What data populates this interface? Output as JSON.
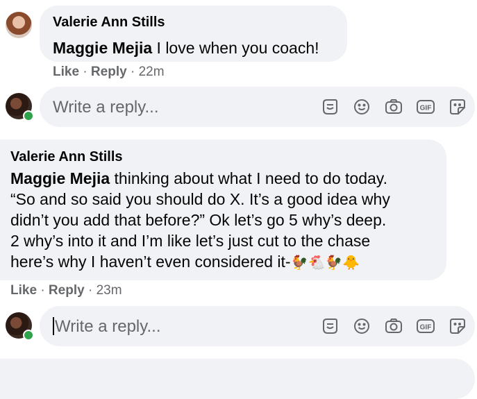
{
  "comment1": {
    "author": "Valerie Ann Stills",
    "mention": "Maggie Mejia",
    "text": " I love when you coach!",
    "like": "Like",
    "reply": "Reply",
    "time": "22m"
  },
  "replybox1": {
    "placeholder": "Write a reply..."
  },
  "comment2": {
    "author": "Valerie Ann Stills",
    "mention": "Maggie Mejia",
    "line1": " thinking about what I need to do today.",
    "line2": "“So and so said you should do X. It’s a good idea why",
    "line3": "didn’t you add that before?” Ok let’s go 5 why’s deep.",
    "line4": "2 why’s into it and I’m like let’s just cut to the chase",
    "line5": "here’s why I haven’t even considered it-",
    "emojis": "🐓🐔🐓🐥",
    "like": "Like",
    "reply": "Reply",
    "time": "23m"
  },
  "replybox2": {
    "placeholder": "Write a reply..."
  },
  "reply_icons": [
    "avatar-sticker-icon",
    "emoji-icon",
    "camera-icon",
    "gif-icon",
    "sticker-icon"
  ],
  "colors": {
    "bubble": "#f0f2f5",
    "meta": "#65676b",
    "online": "#31a24c"
  }
}
